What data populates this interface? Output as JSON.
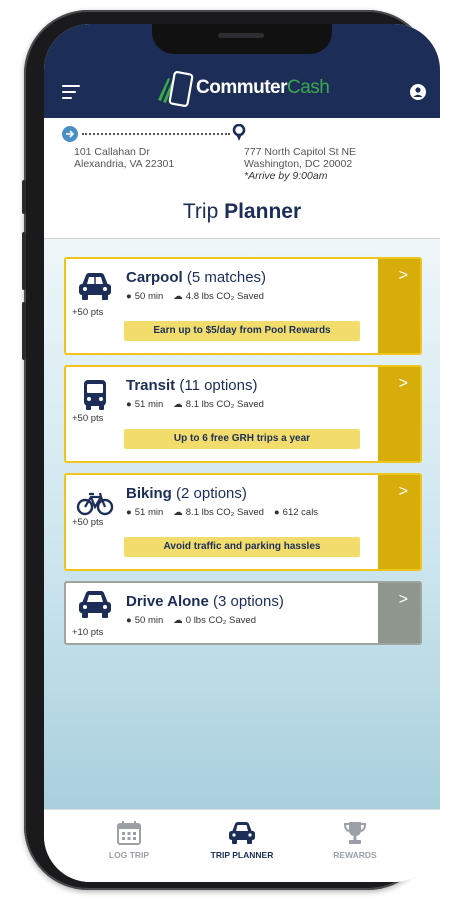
{
  "app": {
    "logo_text_main": "Commuter",
    "logo_text_accent": "Cash"
  },
  "route": {
    "origin_line1": "101 Callahan Dr",
    "origin_line2": "Alexandria, VA 22301",
    "dest_line1": "777 North Capitol St NE",
    "dest_line2": "Washington, DC 20002",
    "arrive_note": "*Arrive by 9:00am"
  },
  "page_title": {
    "light": "Trip",
    "bold": "Planner"
  },
  "options": [
    {
      "name": "Carpool",
      "detail": "(5 matches)",
      "points": "+50 pts",
      "time": "50 min",
      "co2": "4.8 lbs CO₂ Saved",
      "promo": "Earn up to $5/day from Pool Rewards"
    },
    {
      "name": "Transit",
      "detail": "(11 options)",
      "points": "+50 pts",
      "time": "51 min",
      "co2": "8.1 lbs CO₂ Saved",
      "promo": "Up to 6 free GRH trips a year"
    },
    {
      "name": "Biking",
      "detail": "(2 options)",
      "points": "+50 pts",
      "time": "51 min",
      "co2": "8.1 lbs CO₂ Saved",
      "cals": "612 cals",
      "promo": "Avoid traffic and parking hassles"
    },
    {
      "name": "Drive Alone",
      "detail": "(3 options)",
      "points": "+10 pts",
      "time": "50 min",
      "co2": "0 lbs CO₂ Saved"
    }
  ],
  "chevron": ">",
  "tabs": [
    {
      "label": "LOG TRIP",
      "icon": "calendar-icon"
    },
    {
      "label": "TRIP PLANNER",
      "icon": "car-icon"
    },
    {
      "label": "REWARDS",
      "icon": "trophy-icon"
    }
  ],
  "colors": {
    "navy": "#1c2e58",
    "accent_green": "#3aa84b",
    "gold": "#d6ad0a",
    "gold_border": "#f0c419",
    "promo_yellow": "#f2dd6c",
    "gray_bar": "#8f968e",
    "origin_blue": "#4b8fc7"
  }
}
